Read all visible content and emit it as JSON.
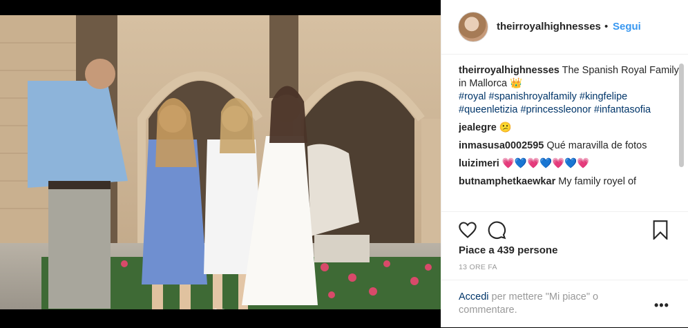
{
  "post": {
    "image_alt": "Photo of four people standing in a stone courtyard",
    "carousel": {
      "count": 2,
      "active_index": 0
    }
  },
  "header": {
    "username": "theirroyalhighnesses",
    "separator": "•",
    "follow_label": "Segui"
  },
  "caption": {
    "username": "theirroyalhighnesses",
    "text": "The Spanish Royal Family in Mallorca 👑",
    "hashtags": "#royal #spanishroyalfamily #kingfelipe #queenletizia #princessleonor #infantasofia"
  },
  "comments": [
    {
      "username": "jealegre",
      "text": "😕"
    },
    {
      "username": "inmasusa0002595",
      "text": "Qué maravilla de fotos"
    },
    {
      "username": "luizimeri",
      "text": "💗💙💗💙💗💙💗"
    },
    {
      "username": "butnamphetkaewkar",
      "text": "My family royel of"
    }
  ],
  "actions": {
    "like_icon": "heart-icon",
    "comment_icon": "comment-icon",
    "save_icon": "bookmark-icon"
  },
  "likes_text": "Piace a 439 persone",
  "timestamp": "13 ORE FA",
  "login_prompt": {
    "link_label": "Accedi",
    "text": " per mettere \"Mi piace\" o commentare.",
    "more_label": "•••"
  },
  "colors": {
    "link_blue": "#3897f0",
    "hashtag_blue": "#003569",
    "text": "#262626",
    "muted": "#999999"
  }
}
